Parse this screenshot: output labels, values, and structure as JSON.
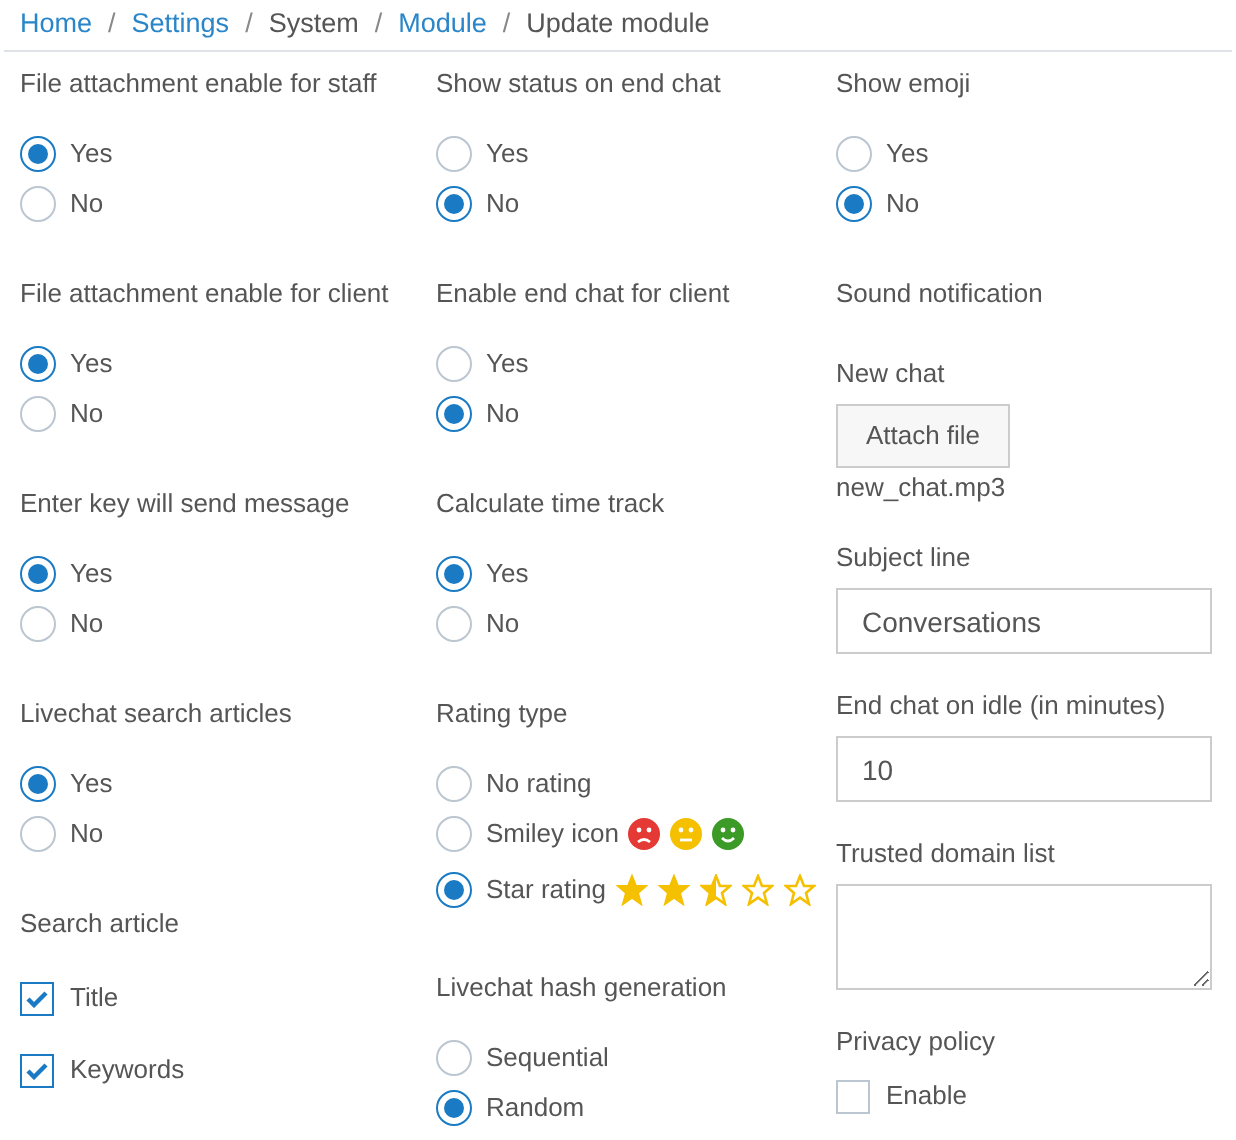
{
  "breadcrumb_separator": "/",
  "breadcrumb": [
    {
      "label": "Home",
      "link": true
    },
    {
      "label": "Settings",
      "link": true
    },
    {
      "label": "System",
      "link": false
    },
    {
      "label": "Module",
      "link": true
    },
    {
      "label": "Update module",
      "link": false
    }
  ],
  "columns": [
    {
      "sections": [
        {
          "kind": "radio_group",
          "label": "File attachment enable for staff",
          "options": [
            {
              "label": "Yes",
              "selected": true
            },
            {
              "label": "No",
              "selected": false
            }
          ]
        },
        {
          "kind": "radio_group",
          "label": "File attachment enable for client",
          "options": [
            {
              "label": "Yes",
              "selected": true
            },
            {
              "label": "No",
              "selected": false
            }
          ]
        },
        {
          "kind": "radio_group",
          "label": "Enter key will send message",
          "options": [
            {
              "label": "Yes",
              "selected": true
            },
            {
              "label": "No",
              "selected": false
            }
          ]
        },
        {
          "kind": "radio_group",
          "label": "Livechat search articles",
          "options": [
            {
              "label": "Yes",
              "selected": true
            },
            {
              "label": "No",
              "selected": false
            }
          ]
        },
        {
          "kind": "checkbox_group",
          "label": "Search article",
          "options": [
            {
              "label": "Title",
              "checked": true
            },
            {
              "label": "Keywords",
              "checked": true
            }
          ]
        }
      ]
    },
    {
      "sections": [
        {
          "kind": "radio_group",
          "label": "Show status on end chat",
          "options": [
            {
              "label": "Yes",
              "selected": false
            },
            {
              "label": "No",
              "selected": true
            }
          ]
        },
        {
          "kind": "radio_group",
          "label": "Enable end chat for client",
          "options": [
            {
              "label": "Yes",
              "selected": false
            },
            {
              "label": "No",
              "selected": true
            }
          ]
        },
        {
          "kind": "radio_group",
          "label": "Calculate time track",
          "options": [
            {
              "label": "Yes",
              "selected": true
            },
            {
              "label": "No",
              "selected": false
            }
          ]
        },
        {
          "kind": "radio_group",
          "label": "Rating type",
          "options": [
            {
              "label": "No rating",
              "selected": false,
              "kind": "plain"
            },
            {
              "label": "Smiley icon",
              "selected": false,
              "kind": "smileys"
            },
            {
              "label": "Star rating",
              "selected": true,
              "kind": "stars",
              "stars": 2.5
            }
          ]
        },
        {
          "kind": "radio_group",
          "label": "Livechat hash generation",
          "options": [
            {
              "label": "Sequential",
              "selected": false
            },
            {
              "label": "Random",
              "selected": true
            }
          ]
        }
      ]
    },
    {
      "sections": [
        {
          "kind": "radio_group",
          "label": "Show emoji",
          "options": [
            {
              "label": "Yes",
              "selected": false
            },
            {
              "label": "No",
              "selected": true
            }
          ]
        },
        {
          "kind": "heading",
          "label": "Sound notification"
        },
        {
          "kind": "file",
          "label": "New chat",
          "button": "Attach file",
          "filename": "new_chat.mp3"
        },
        {
          "kind": "text_input",
          "label": "Subject line",
          "value": "Conversations"
        },
        {
          "kind": "text_input",
          "label": "End chat on idle (in minutes)",
          "value": "10"
        },
        {
          "kind": "textarea",
          "label": "Trusted domain list"
        },
        {
          "kind": "checkbox_list",
          "label": "Privacy policy",
          "options": [
            {
              "label": "Enable",
              "checked": false
            }
          ]
        }
      ]
    }
  ]
}
